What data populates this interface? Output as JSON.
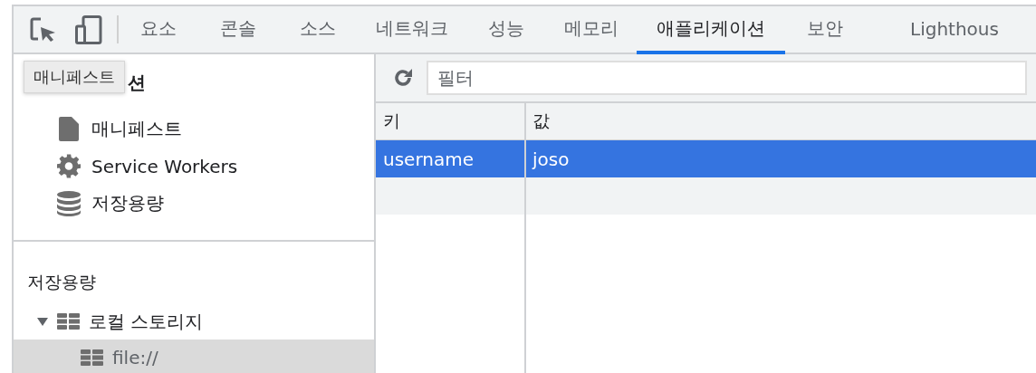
{
  "toolbar": {
    "tabs": [
      {
        "label": "요소",
        "selected": false
      },
      {
        "label": "콘솔",
        "selected": false
      },
      {
        "label": "소스",
        "selected": false
      },
      {
        "label": "네트워크",
        "selected": false
      },
      {
        "label": "성능",
        "selected": false
      },
      {
        "label": "메모리",
        "selected": false
      },
      {
        "label": "애플리케이션",
        "selected": true
      },
      {
        "label": "보안",
        "selected": false
      },
      {
        "label": "Lighthous",
        "selected": false
      }
    ]
  },
  "sidebar": {
    "section_heading": "션",
    "tooltip": "매니페스트",
    "items": [
      {
        "label": "매니페스트",
        "kind": "file"
      },
      {
        "label": "Service Workers",
        "kind": "gear"
      },
      {
        "label": "저장용량",
        "kind": "database"
      }
    ],
    "storage_heading": "저장용량",
    "tree": [
      {
        "label": "로컬 스토리지",
        "expanded": true,
        "selected": false,
        "children": [
          {
            "label": "file://",
            "selected": true
          }
        ]
      }
    ]
  },
  "filter": {
    "placeholder": "필터"
  },
  "table": {
    "columns": [
      "키",
      "값"
    ],
    "rows": [
      {
        "cells": [
          "username",
          "joso"
        ],
        "selected": true
      }
    ]
  }
}
